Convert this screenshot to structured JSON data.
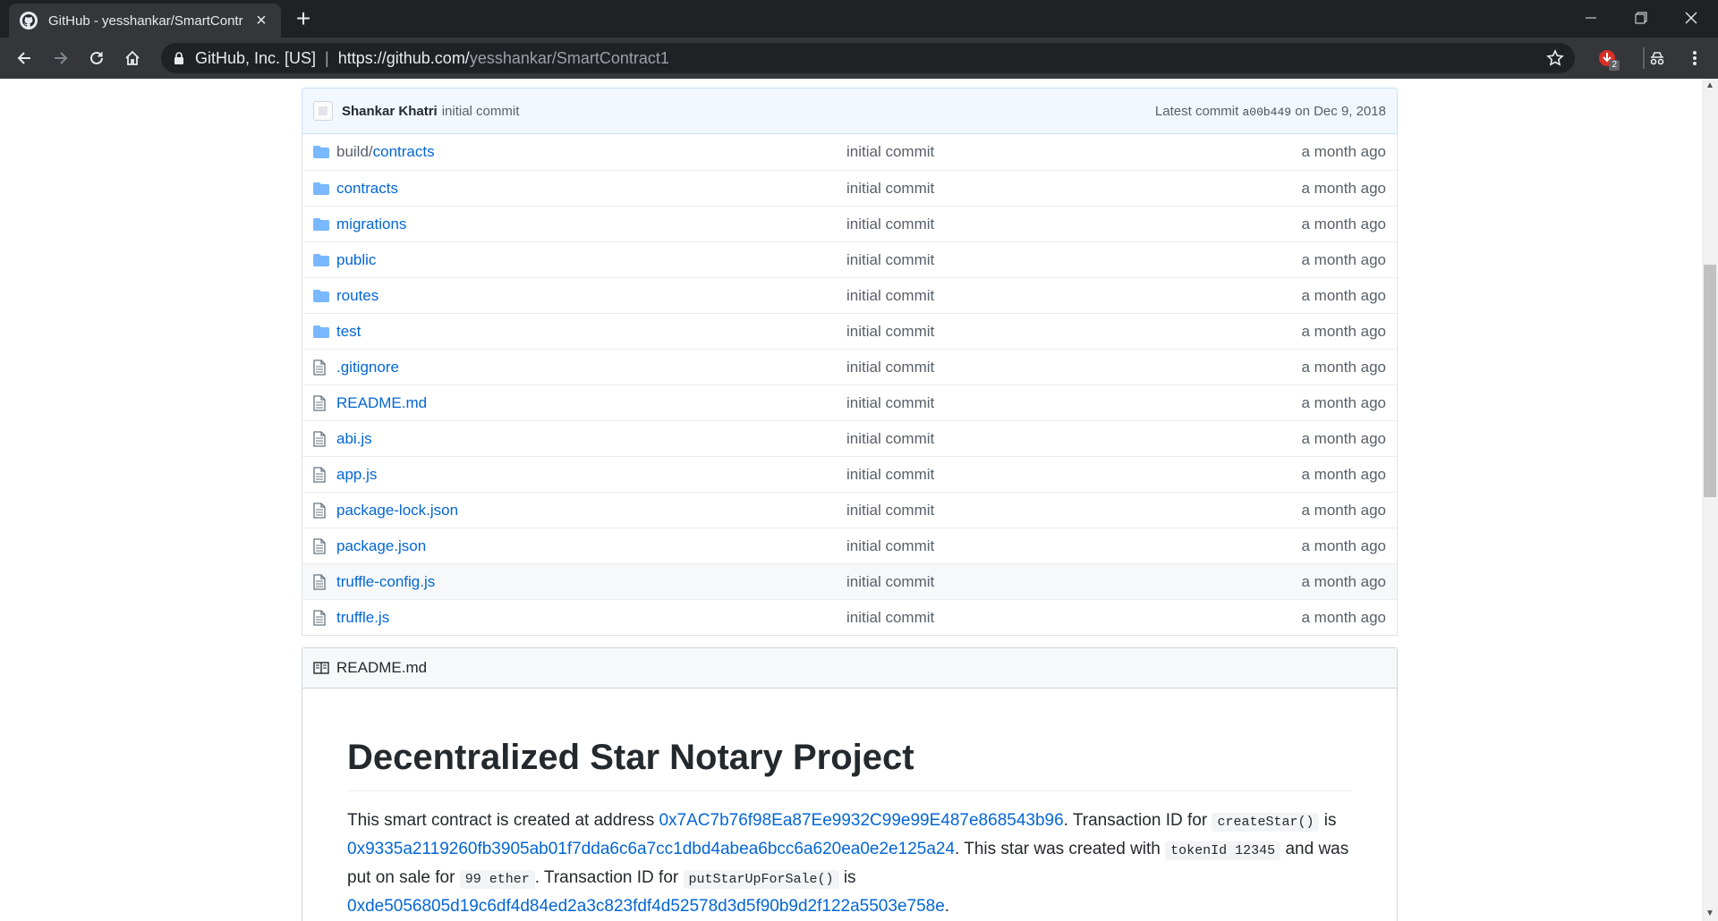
{
  "browser": {
    "tab_title": "GitHub - yesshankar/SmartContr",
    "site_info": "GitHub, Inc. [US]",
    "url_host": "https://github.com/",
    "url_path": "yesshankar/SmartContract1",
    "ext_badge": "2"
  },
  "commit": {
    "author": "Shankar Khatri",
    "message": "initial commit",
    "latest_label": "Latest commit",
    "sha": "a00b449",
    "date_text": "on Dec 9, 2018"
  },
  "files": [
    {
      "type": "dir",
      "prefix": "build/",
      "name": "contracts",
      "message": "initial commit",
      "age": "a month ago"
    },
    {
      "type": "dir",
      "prefix": "",
      "name": "contracts",
      "message": "initial commit",
      "age": "a month ago"
    },
    {
      "type": "dir",
      "prefix": "",
      "name": "migrations",
      "message": "initial commit",
      "age": "a month ago"
    },
    {
      "type": "dir",
      "prefix": "",
      "name": "public",
      "message": "initial commit",
      "age": "a month ago"
    },
    {
      "type": "dir",
      "prefix": "",
      "name": "routes",
      "message": "initial commit",
      "age": "a month ago"
    },
    {
      "type": "dir",
      "prefix": "",
      "name": "test",
      "message": "initial commit",
      "age": "a month ago"
    },
    {
      "type": "file",
      "prefix": "",
      "name": ".gitignore",
      "message": "initial commit",
      "age": "a month ago"
    },
    {
      "type": "file",
      "prefix": "",
      "name": "README.md",
      "message": "initial commit",
      "age": "a month ago"
    },
    {
      "type": "file",
      "prefix": "",
      "name": "abi.js",
      "message": "initial commit",
      "age": "a month ago"
    },
    {
      "type": "file",
      "prefix": "",
      "name": "app.js",
      "message": "initial commit",
      "age": "a month ago"
    },
    {
      "type": "file",
      "prefix": "",
      "name": "package-lock.json",
      "message": "initial commit",
      "age": "a month ago"
    },
    {
      "type": "file",
      "prefix": "",
      "name": "package.json",
      "message": "initial commit",
      "age": "a month ago"
    },
    {
      "type": "file",
      "prefix": "",
      "name": "truffle-config.js",
      "message": "initial commit",
      "age": "a month ago"
    },
    {
      "type": "file",
      "prefix": "",
      "name": "truffle.js",
      "message": "initial commit",
      "age": "a month ago"
    }
  ],
  "readme": {
    "header": "README.md",
    "title": "Decentralized Star Notary Project",
    "p1_t1": "This smart contract is created at address ",
    "address": "0x7AC7b76f98Ea87Ee9932C99e99E487e868543b96",
    "p1_t2": ". Transaction ID for ",
    "code1": "createStar()",
    "p1_t3": " is ",
    "tx1": "0x9335a2119260fb3905ab01f7dda6c6a7cc1dbd4abea6bcc6a620ea0e2e125a24",
    "p1_t4": ". This star was created with ",
    "code2": "tokenId 12345",
    "p1_t5": " and was put on sale for ",
    "code3": "99 ether",
    "p1_t6": ". Transaction ID for ",
    "code4": "putStarUpForSale()",
    "p1_t7": " is ",
    "tx2": "0xde5056805d19c6df4d84ed2a3c823fdf4d52578d3d5f90b9d2f122a5503e758e",
    "p1_t8": "."
  }
}
